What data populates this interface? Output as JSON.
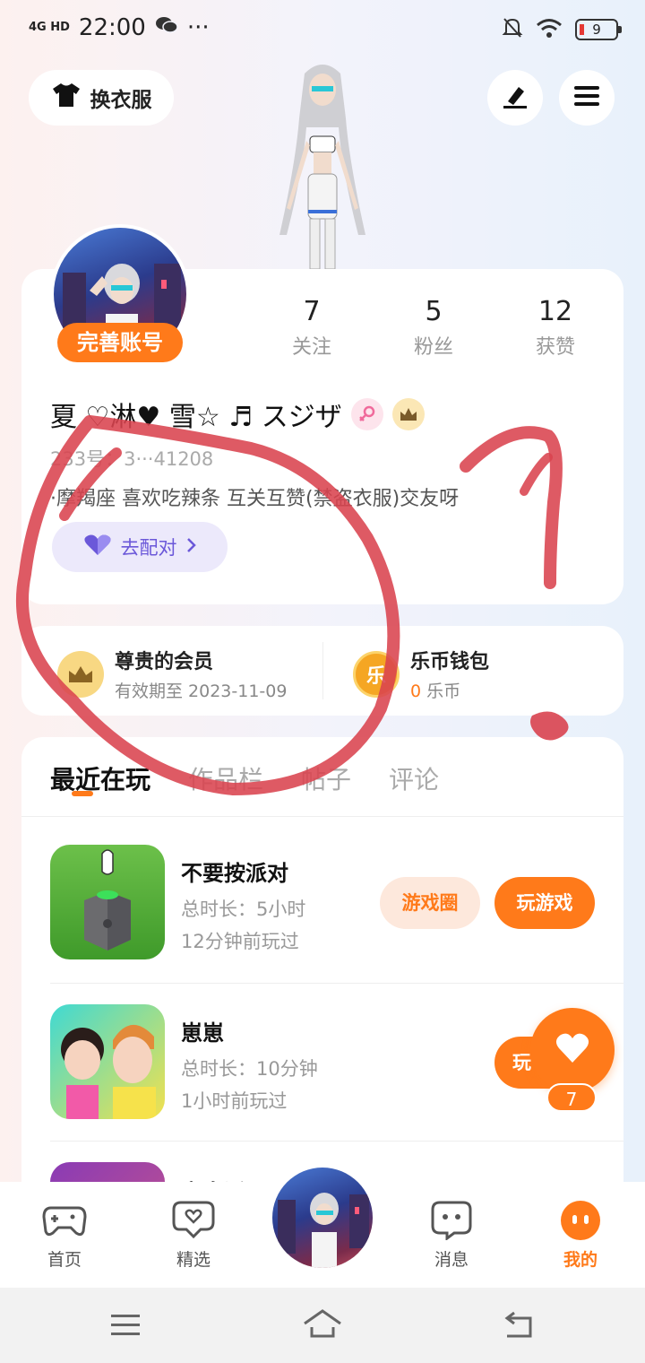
{
  "status_bar": {
    "network": "4G HD",
    "time": "22:00",
    "more": "···",
    "battery": "9"
  },
  "header": {
    "outfit_label": "换衣服"
  },
  "profile": {
    "complete_account_label": "完善账号",
    "stats": [
      {
        "num": "7",
        "label": "关注"
      },
      {
        "num": "5",
        "label": "粉丝"
      },
      {
        "num": "12",
        "label": "获赞"
      }
    ],
    "nickname": "夏 ♡淋♥ 雪☆  ♬ スジザ",
    "id_line": "233号：3···41208",
    "bio": "·摩羯座  喜欢吃辣条  互关互赞(禁盗衣服)交友呀",
    "match_label": "去配对"
  },
  "vip": {
    "member_title": "尊贵的会员",
    "member_sub": "有效期至 2023-11-09",
    "coin_glyph": "乐",
    "wallet_title": "乐币钱包",
    "wallet_amount": "0",
    "wallet_unit": "乐币"
  },
  "tabs": [
    "最近在玩",
    "作品栏",
    "帖子",
    "评论"
  ],
  "games": [
    {
      "title": "不要按派对",
      "duration": "总时长：5小时",
      "last_played": "12分钟前玩过",
      "circle_label": "游戏圈",
      "play_label": "玩游戏"
    },
    {
      "title": "崽崽",
      "duration": "总时长：10分钟",
      "last_played": "1小时前玩过",
      "play_label": "玩"
    },
    {
      "title": "变身派"
    }
  ],
  "float_like_count": "7",
  "bottom_nav": [
    {
      "label": "首页",
      "icon": "gamepad-icon"
    },
    {
      "label": "精选",
      "icon": "heart-bubble-icon"
    },
    {
      "label": "消息",
      "icon": "chat-icon"
    },
    {
      "label": "我的",
      "icon": "face-icon"
    }
  ],
  "colors": {
    "accent": "#ff7a1a",
    "match": "#6b58d9",
    "annotation": "#d9434f"
  }
}
